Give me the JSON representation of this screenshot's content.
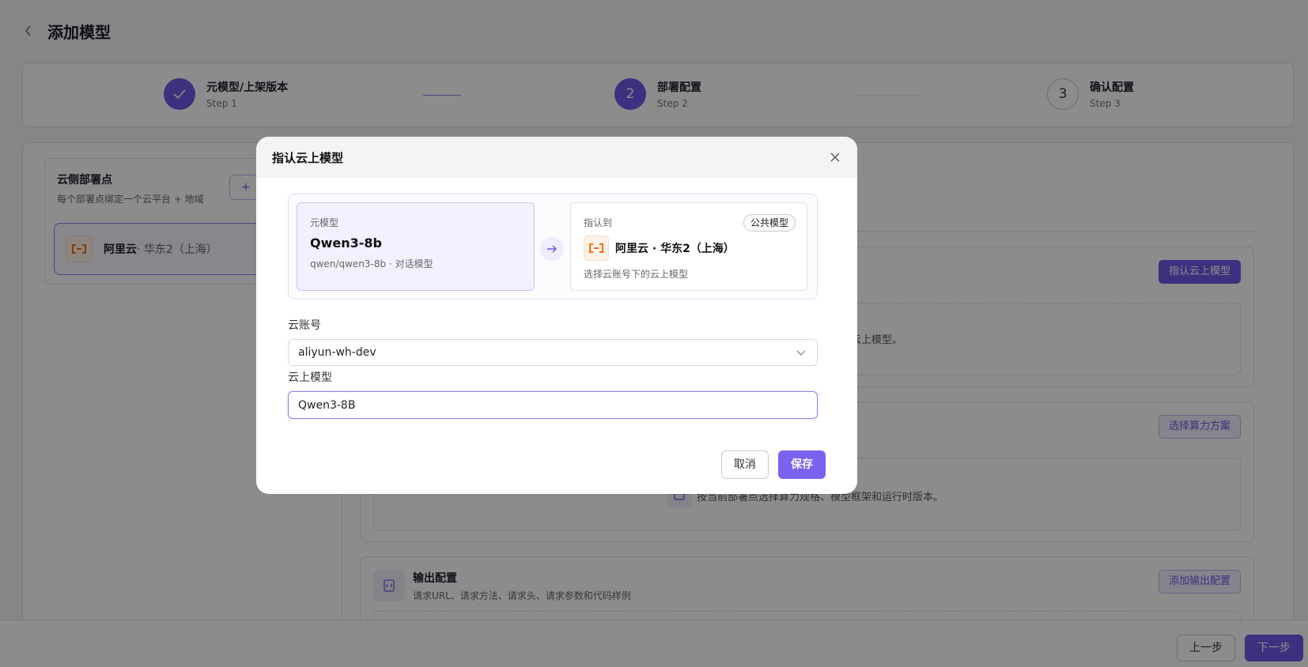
{
  "page": {
    "title": "添加模型"
  },
  "steps": [
    {
      "title": "元模型/上架版本",
      "sub": "Step 1",
      "number": "1",
      "state": "done"
    },
    {
      "title": "部署配置",
      "sub": "Step 2",
      "number": "2",
      "state": "active"
    },
    {
      "title": "确认配置",
      "sub": "Step 3",
      "number": "3",
      "state": "todo"
    }
  ],
  "left_panel": {
    "title": "云侧部署点",
    "subtitle": "每个部署点绑定一个云平台 + 地域",
    "add_label": "+",
    "item": {
      "provider": "阿里云",
      "region": "· 华东2（上海）"
    }
  },
  "sections": {
    "mapping": {
      "button_label": "指认云上模型",
      "hint": "的云上模型。"
    },
    "compute": {
      "button_label": "选择算力方案",
      "hint": "按当前部署点选择算力规格、模型框架和运行时版本。"
    },
    "output": {
      "title": "输出配置",
      "subtitle": "请求URL、请求方法、请求头、请求参数和代码样例",
      "button_label": "添加输出配置"
    }
  },
  "footer": {
    "prev_label": "上一步",
    "next_label": "下一步"
  },
  "modal": {
    "title": "指认云上模型",
    "source": {
      "label": "元模型",
      "name": "Qwen3-8b",
      "meta": "qwen/qwen3-8b · 对话模型"
    },
    "target": {
      "label": "指认到",
      "badge": "公共模型",
      "name": "阿里云 · 华东2（上海）",
      "hint": "选择云账号下的云上模型"
    },
    "account": {
      "label": "云账号",
      "value": "aliyun-wh-dev"
    },
    "cloud_model": {
      "label": "云上模型",
      "value": "Qwen3-8B"
    },
    "cancel_label": "取消",
    "save_label": "保存"
  },
  "colors": {
    "primary": "#6e5ae6",
    "aliyun": "#ff6a00"
  }
}
